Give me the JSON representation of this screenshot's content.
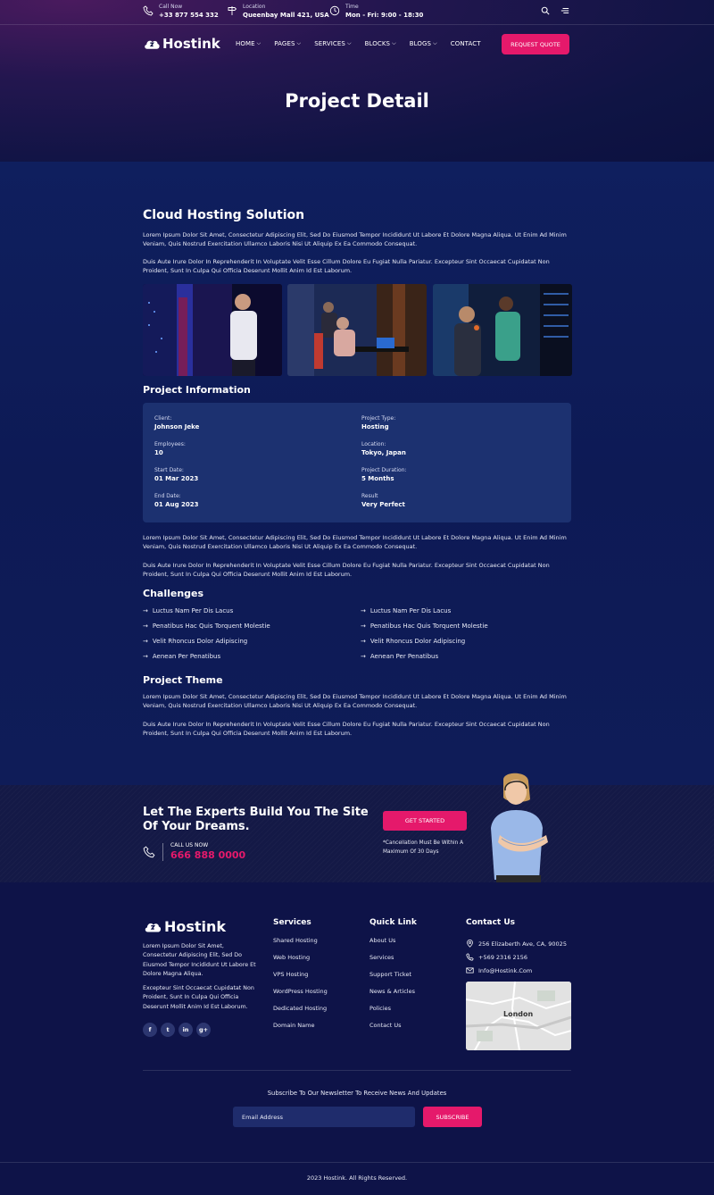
{
  "topbar": {
    "call": {
      "label": "Call Now",
      "value": "+33 877 554 332"
    },
    "location": {
      "label": "Location",
      "value": "Queenbay Mall 421, USA"
    },
    "time": {
      "label": "Time",
      "value": "Mon - Fri: 9:00 - 18:30"
    }
  },
  "brand": {
    "name": "Hostink",
    "accent": "#e5196b"
  },
  "nav": {
    "items": [
      "HOME",
      "PAGES",
      "SERVICES",
      "BLOCKS",
      "BLOGS",
      "CONTACT"
    ],
    "quote_label": "REQUEST QUOTE"
  },
  "hero": {
    "title": "Project Detail"
  },
  "project": {
    "title": "Cloud Hosting Solution",
    "intro_p1": "Lorem Ipsum Dolor Sit Amet, Consectetur Adipiscing Elit, Sed Do Eiusmod Tempor Incididunt Ut Labore Et Dolore Magna Aliqua. Ut Enim Ad Minim Veniam, Quis Nostrud Exercitation Ullamco Laboris Nisi Ut Aliquip Ex Ea Commodo Consequat.",
    "intro_p2": "Duis Aute Irure Dolor In Reprehenderit In Voluptate Velit Esse Cillum Dolore Eu Fugiat Nulla Pariatur. Excepteur Sint Occaecat Cupidatat Non Proident, Sunt In Culpa Qui Officia Deserunt Mollit Anim Id Est Laborum."
  },
  "info": {
    "title": "Project Information",
    "client": {
      "label": "Client:",
      "value": "Johnson Jeke"
    },
    "type": {
      "label": "Project Type:",
      "value": "Hosting"
    },
    "employees": {
      "label": "Employees:",
      "value": "10"
    },
    "location": {
      "label": "Location:",
      "value": "Tokyo, Japan"
    },
    "start": {
      "label": "Start Date:",
      "value": "01 Mar 2023"
    },
    "duration": {
      "label": "Project Duration:",
      "value": "5 Months"
    },
    "end": {
      "label": "End Date:",
      "value": "01 Aug 2023"
    },
    "result": {
      "label": "Result",
      "value": "Very Perfect"
    }
  },
  "after_info": {
    "p1": "Lorem Ipsum Dolor Sit Amet, Consectetur Adipiscing Elit, Sed Do Eiusmod Tempor Incididunt Ut Labore Et Dolore Magna Aliqua. Ut Enim Ad Minim Veniam, Quis Nostrud Exercitation Ullamco Laboris Nisi Ut Aliquip Ex Ea Commodo Consequat.",
    "p2": "Duis Aute Irure Dolor In Reprehenderit In Voluptate Velit Esse Cillum Dolore Eu Fugiat Nulla Pariatur. Excepteur Sint Occaecat Cupidatat Non Proident, Sunt In Culpa Qui Officia Deserunt Mollit Anim Id Est Laborum."
  },
  "challenges": {
    "title": "Challenges",
    "left": [
      "Luctus Nam Per Dis Lacus",
      "Penatibus Hac Quis Torquent Molestie",
      "Velit Rhoncus Dolor Adipiscing",
      "Aenean Per Penatibus"
    ],
    "right": [
      "Luctus Nam Per Dis Lacus",
      "Penatibus Hac Quis Torquent Molestie",
      "Velit Rhoncus Dolor Adipiscing",
      "Aenean Per Penatibus"
    ]
  },
  "theme": {
    "title": "Project Theme",
    "p1": "Lorem Ipsum Dolor Sit Amet, Consectetur Adipiscing Elit, Sed Do Eiusmod Tempor Incididunt Ut Labore Et Dolore Magna Aliqua. Ut Enim Ad Minim Veniam, Quis Nostrud Exercitation Ullamco Laboris Nisi Ut Aliquip Ex Ea Commodo Consequat.",
    "p2": "Duis Aute Irure Dolor In Reprehenderit In Voluptate Velit Esse Cillum Dolore Eu Fugiat Nulla Pariatur. Excepteur Sint Occaecat Cupidatat Non Proident, Sunt In Culpa Qui Officia Deserunt Mollit Anim Id Est Laborum."
  },
  "cta": {
    "title": "Let The Experts Build You The Site Of Your Dreams.",
    "call_label": "CALL US NOW",
    "call_number": "666 888 0000",
    "button": "GET STARTED",
    "note": "*Cancellation Must Be Within A Maximum Of 30 Days"
  },
  "footer": {
    "about_p1": "Lorem Ipsum Dolor Sit Amet, Consectetur Adipiscing Elit, Sed Do Eiusmod Tempor Incididunt Ut Labore Et Dolore Magna Aliqua.",
    "about_p2": "Excepteur Sint Occaecat Cupidatat Non Proident, Sunt In Culpa Qui Officia Deserunt Mollit Anim Id Est Laborum.",
    "socials": [
      "f",
      "t",
      "in",
      "g+"
    ],
    "services": {
      "title": "Services",
      "links": [
        "Shared Hosting",
        "Web Hosting",
        "VPS Hosting",
        "WordPress Hosting",
        "Dedicated Hosting",
        "Domain Name"
      ]
    },
    "quick": {
      "title": "Quick Link",
      "links": [
        "About Us",
        "Services",
        "Support Ticket",
        "News & Articles",
        "Policies",
        "Contact Us"
      ]
    },
    "contact": {
      "title": "Contact Us",
      "address": "256 Elizaberth Ave, CA, 90025",
      "phone": "+569 2316 2156",
      "email": "Info@Hostink.Com",
      "map_label": "London"
    },
    "newsletter_text": "Subscribe To Our Newsletter To Receive News And Updates",
    "email_placeholder": "Email Address",
    "subscribe": "SUBSCRIBE",
    "copyright": "2023 Hostink. All Rights Reserved."
  }
}
